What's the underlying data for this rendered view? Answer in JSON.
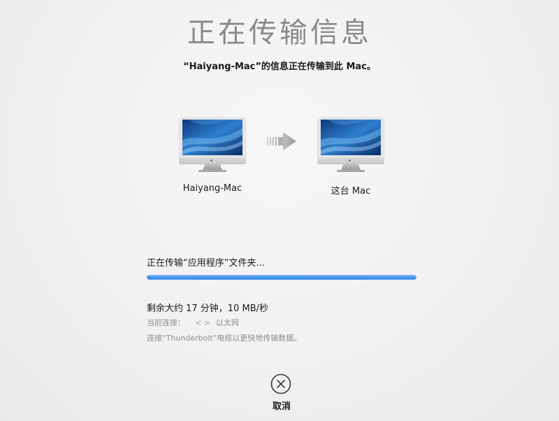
{
  "header": {
    "title": "正在传输信息",
    "subtitle": "“Haiyang-Mac”的信息正在传输到此 Mac。"
  },
  "source_computer": {
    "label": "Haiyang-Mac",
    "icon": "imac-icon"
  },
  "target_computer": {
    "label": "这台 Mac",
    "icon": "imac-icon"
  },
  "transfer_arrow_icon": "transfer-arrow-icon",
  "progress": {
    "status": "正在传输“应用程序”文件夹...",
    "percent": 100,
    "color": "#3d8ee6"
  },
  "estimate": {
    "time_remaining": "剩余大约 17 分钟，10 MB/秒"
  },
  "connection": {
    "label": "当前连接：",
    "icon": "ethernet-arrows-icon",
    "icon_glyph": "<·>",
    "value": "以太网"
  },
  "hint": "连接“Thunderbolt”电缆以更快地传输数据。",
  "cancel": {
    "label": "取消",
    "icon": "cancel-x-circle-icon"
  }
}
